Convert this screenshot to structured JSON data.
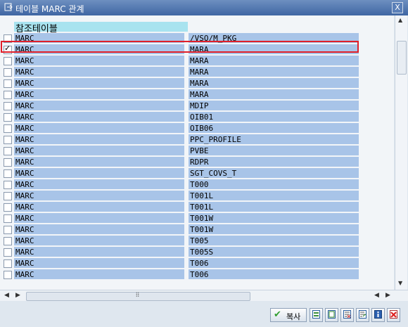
{
  "window": {
    "title": "테이블 MARC 관계",
    "close_label": "X"
  },
  "table": {
    "header": "참조테이블",
    "rows": [
      {
        "checked": false,
        "left": "MARC",
        "right": "/VSO/M_PKG"
      },
      {
        "checked": true,
        "left": "MARC",
        "right": "MARA"
      },
      {
        "checked": false,
        "left": "MARC",
        "right": "MARA"
      },
      {
        "checked": false,
        "left": "MARC",
        "right": "MARA"
      },
      {
        "checked": false,
        "left": "MARC",
        "right": "MARA"
      },
      {
        "checked": false,
        "left": "MARC",
        "right": "MARA"
      },
      {
        "checked": false,
        "left": "MARC",
        "right": "MDIP"
      },
      {
        "checked": false,
        "left": "MARC",
        "right": "OIB01"
      },
      {
        "checked": false,
        "left": "MARC",
        "right": "OIB06"
      },
      {
        "checked": false,
        "left": "MARC",
        "right": "PPC_PROFILE"
      },
      {
        "checked": false,
        "left": "MARC",
        "right": "PVBE"
      },
      {
        "checked": false,
        "left": "MARC",
        "right": "RDPR"
      },
      {
        "checked": false,
        "left": "MARC",
        "right": "SGT_COVS_T"
      },
      {
        "checked": false,
        "left": "MARC",
        "right": "T000"
      },
      {
        "checked": false,
        "left": "MARC",
        "right": "T001L"
      },
      {
        "checked": false,
        "left": "MARC",
        "right": "T001L"
      },
      {
        "checked": false,
        "left": "MARC",
        "right": "T001W"
      },
      {
        "checked": false,
        "left": "MARC",
        "right": "T001W"
      },
      {
        "checked": false,
        "left": "MARC",
        "right": "T005"
      },
      {
        "checked": false,
        "left": "MARC",
        "right": "T005S"
      },
      {
        "checked": false,
        "left": "MARC",
        "right": "T006"
      },
      {
        "checked": false,
        "left": "MARC",
        "right": "T006"
      }
    ]
  },
  "footer": {
    "copy_label": "복사",
    "icons": [
      "choose-icon",
      "select-all-icon",
      "deselect-icon",
      "display-icon",
      "info-icon",
      "cancel-icon"
    ]
  },
  "colors": {
    "row_bg": "#a8c4e8",
    "header_bg": "#a8e3ef",
    "highlight": "#e0202a"
  }
}
